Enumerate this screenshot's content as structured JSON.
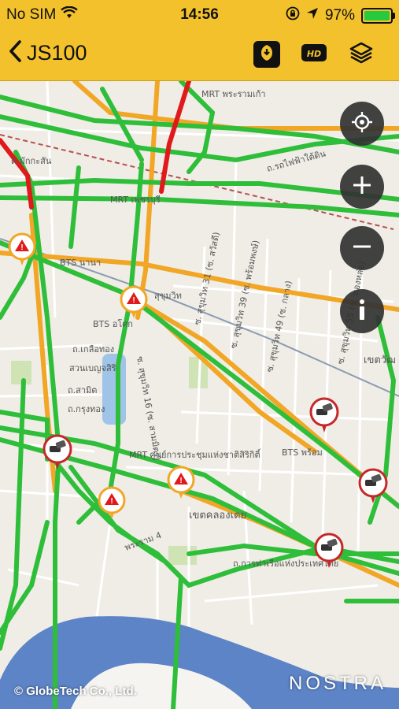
{
  "status_bar": {
    "carrier": "No SIM",
    "time": "14:56",
    "battery_percent": "97%",
    "battery_level": 0.97,
    "icons": [
      "wifi-icon",
      "orientation-lock-icon",
      "location-arrow-icon",
      "battery-icon"
    ]
  },
  "nav": {
    "back_title": "JS100",
    "buttons": [
      "incident-report-icon",
      "hd-camera-icon",
      "layers-icon"
    ]
  },
  "map_controls": [
    "locate-me-icon",
    "zoom-in-icon",
    "zoom-out-icon",
    "info-icon"
  ],
  "map_labels": {
    "mrt_phraram9": "MRT พระรามเก้า",
    "makkasan": "ต.มักกะสัน",
    "rot_fai": "ถ.รถไฟฟ้าใต้ดิน",
    "mrt_phetchaburi": "MRT เพชรบุรี",
    "bts_nana": "BTS นานา",
    "bts_asok": "BTS อโศก",
    "sukhumvit": "สุขุมวิท",
    "soi_31": "ซ. สุขุมวิท 31 (ซ. สวัสดี)",
    "soi_39": "ซ. สุขุมวิท 39 (ซ. พร้อมพงษ์)",
    "soi_49": "ซ. สุขุมวิท 49 (ซ. กลาง)",
    "soi_55": "ซ. สุขุมวิท 55 (ซ. ทองหล่อ)",
    "watthana": "เขตวัฒ",
    "kluaithong": "ถ.เกลือทอง",
    "benjasiri": "สวนเบญจสิริ",
    "samit": "ถ.สามิต",
    "krungthong": "ถ.กรุงทอง",
    "mrt_sirikit": "MRT ศูนย์การประชุมแห่งชาติสิริกิติ์",
    "bts_phromphong": "BTS พร้อม",
    "khlongtoei": "เขตคลองเตย",
    "rama4": "พระราม 4",
    "port_road": "ถ.การท่าเรือแห่งประเทศไทย",
    "soi_sukhumvit_16": "ซ. สุขุมวิท 16 (ซ. สามมิตร)",
    "copyright": "© GlobeTech Co., Ltd.",
    "brand": "NOSTRA"
  },
  "traffic_colors": {
    "free": "#2fbe3a",
    "slow": "#f2a626",
    "jam": "#e0191b"
  },
  "incident_icons": [
    "incident-warning-icon",
    "accident-icon"
  ]
}
